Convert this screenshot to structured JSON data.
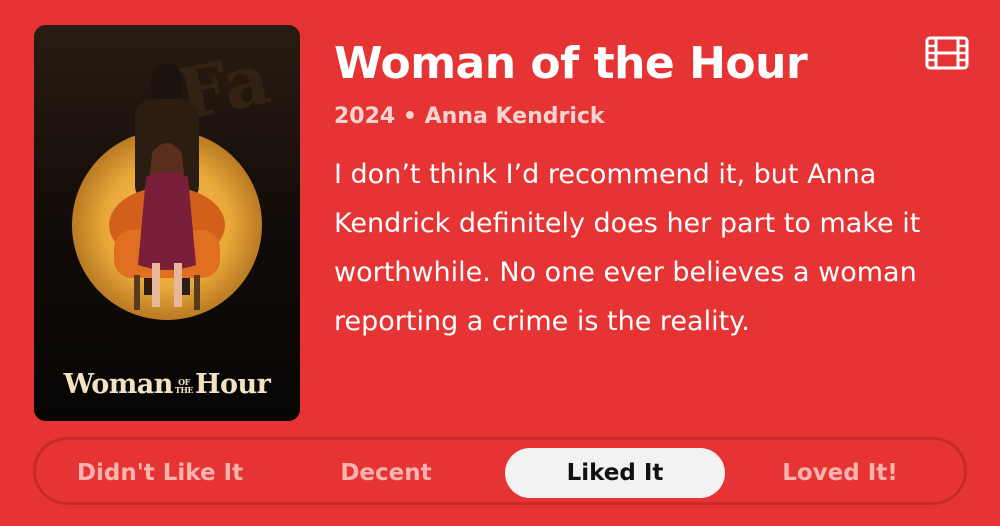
{
  "poster": {
    "title_main_1": "Woman",
    "title_small_1": "OF",
    "title_small_2": "THE",
    "title_main_2": "Hour"
  },
  "movie": {
    "title": "Woman of the Hour",
    "year": "2024",
    "separator": "•",
    "actor": "Anna Kendrick",
    "review": "I don’t think I’d recommend it, but Anna Kendrick definitely does her part to make it worthwhile. No one ever believes a woman reporting a crime is the reality."
  },
  "icons": {
    "media_type": "film-icon"
  },
  "rating": {
    "options": [
      "Didn't Like It",
      "Decent",
      "Liked It",
      "Loved It!"
    ],
    "selected": "Liked It"
  },
  "colors": {
    "background": "#e53433",
    "title": "#ffffff",
    "meta": "#fbd4d1",
    "unselected_option": "#fbb3ae",
    "selected_bg": "#f2f2f2"
  }
}
